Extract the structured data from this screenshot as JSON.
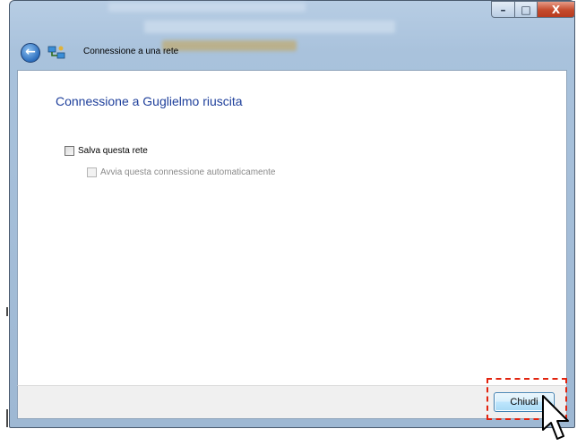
{
  "window": {
    "title": "Connessione a una rete",
    "caption_buttons": {
      "minimize": "–",
      "maximize": "□",
      "close": "X"
    }
  },
  "header": {
    "back_icon": "back-arrow-icon",
    "network_icon": "network-icon",
    "title": "Connessione a una rete"
  },
  "main": {
    "heading": "Connessione a Guglielmo riuscita",
    "options": [
      {
        "label": "Salva questa rete",
        "checked": false,
        "enabled": true
      },
      {
        "label": "Avvia questa connessione automaticamente",
        "checked": false,
        "enabled": false
      }
    ]
  },
  "footer": {
    "close_label": "Chiudi"
  },
  "annotation": {
    "highlight_color": "#e2230e",
    "cursor_icon": "mouse-pointer-icon"
  },
  "colors": {
    "heading": "#1e3f9b",
    "chrome": "#a9c2dc",
    "close_caption": "#c44a2c"
  }
}
